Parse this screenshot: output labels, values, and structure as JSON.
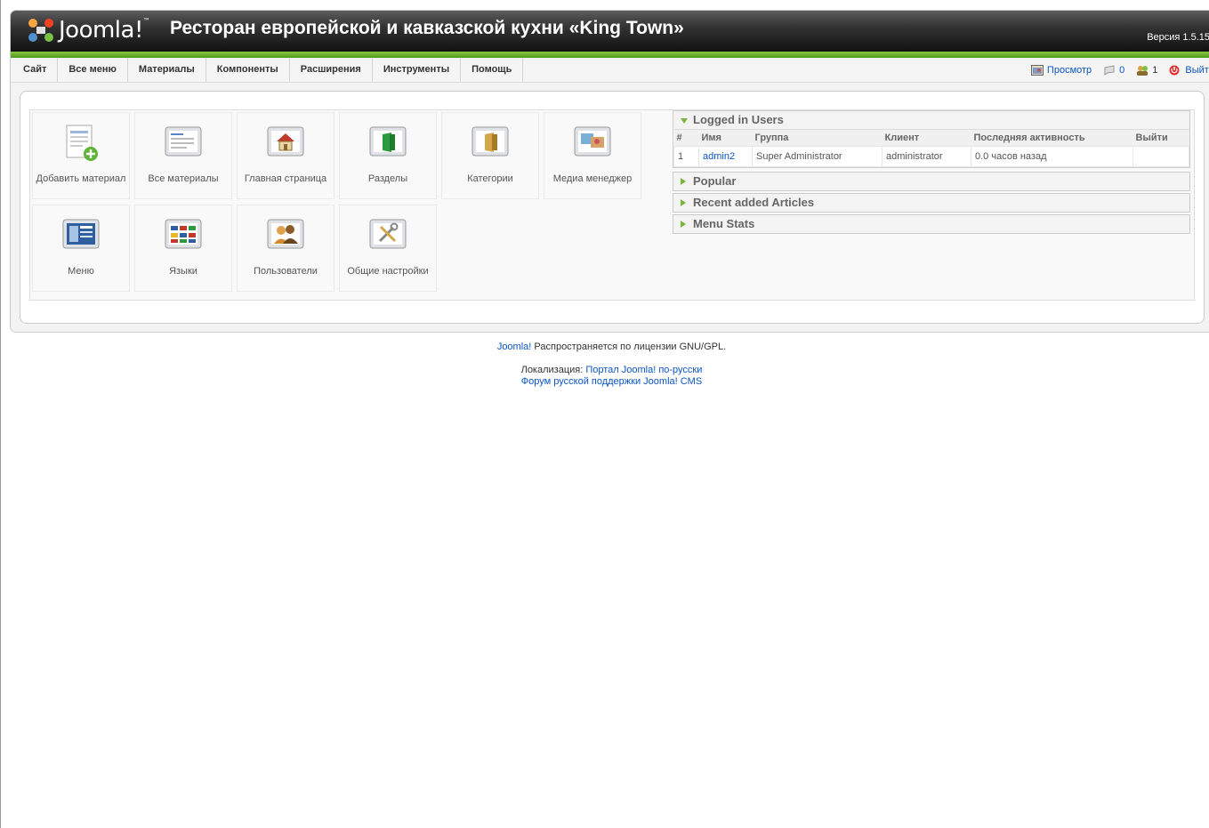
{
  "header": {
    "logo_text": "Joomla!",
    "site_title": "Ресторан европейской и кавказской кухни «King Town»",
    "version": "Версия 1.5.15"
  },
  "menu": [
    "Сайт",
    "Все меню",
    "Материалы",
    "Компоненты",
    "Расширения",
    "Инструменты",
    "Помощь"
  ],
  "status": {
    "preview": "Просмотр",
    "messages": "0",
    "users_online": "1",
    "logout": "Выйти"
  },
  "cpanel": [
    {
      "label": "Добавить материал",
      "icon": "add-article-icon"
    },
    {
      "label": "Все материалы",
      "icon": "articles-icon"
    },
    {
      "label": "Главная страница",
      "icon": "frontpage-icon"
    },
    {
      "label": "Разделы",
      "icon": "sections-icon"
    },
    {
      "label": "Категории",
      "icon": "categories-icon"
    },
    {
      "label": "Медиа менеджер",
      "icon": "media-icon"
    },
    {
      "label": "Меню",
      "icon": "menu-icon"
    },
    {
      "label": "Языки",
      "icon": "languages-icon"
    },
    {
      "label": "Пользователи",
      "icon": "users-icon"
    },
    {
      "label": "Общие настройки",
      "icon": "config-icon"
    }
  ],
  "panes": {
    "logged_in": {
      "title": "Logged in Users",
      "columns": [
        "#",
        "Имя",
        "Группа",
        "Клиент",
        "Последняя активность",
        "Выйти"
      ],
      "rows": [
        {
          "num": "1",
          "name": "admin2",
          "group": "Super Administrator",
          "client": "administrator",
          "activity": "0.0 часов назад",
          "logout": ""
        }
      ]
    },
    "popular": "Popular",
    "recent": "Recent added Articles",
    "menu_stats": "Menu Stats"
  },
  "footer": {
    "joomla": "Joomla!",
    "license": " Распространяется по лицензии GNU/GPL.",
    "loc_label": "Локализация: ",
    "portal": "Портал Joomla! по-русски",
    "forum": "Форум русской поддержки Joomla! CMS"
  },
  "colors": {
    "accent_green": "#7db73f",
    "link": "#0b55c4"
  }
}
